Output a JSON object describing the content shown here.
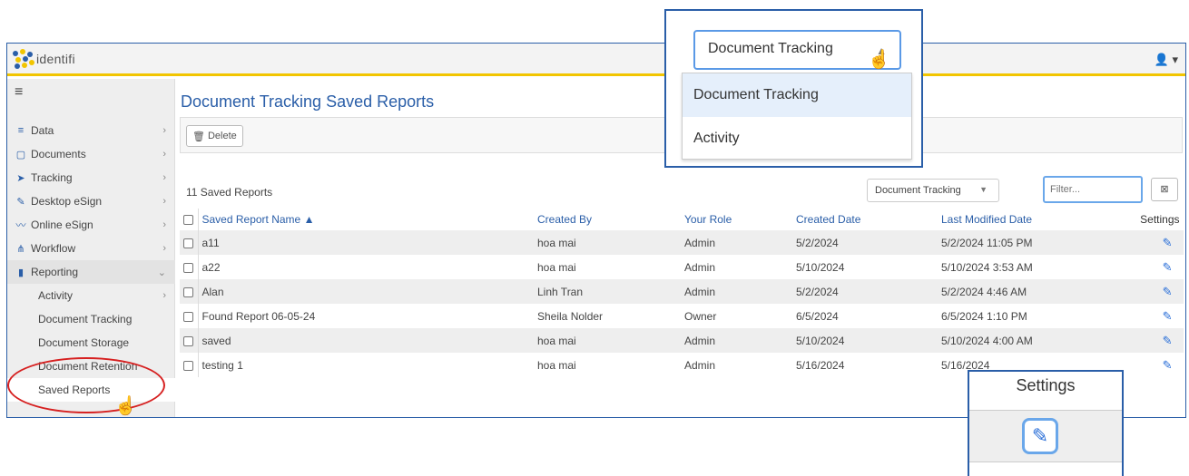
{
  "app": {
    "name": "identifi"
  },
  "sidebar": {
    "items": [
      {
        "label": "Data",
        "icon": "database-icon",
        "glyph": "≡"
      },
      {
        "label": "Documents",
        "icon": "clipboard-icon",
        "glyph": "▢"
      },
      {
        "label": "Tracking",
        "icon": "paper-plane-icon",
        "glyph": "➤"
      },
      {
        "label": "Desktop eSign",
        "icon": "pen-icon",
        "glyph": "✎"
      },
      {
        "label": "Online eSign",
        "icon": "signature-icon",
        "glyph": "〰"
      },
      {
        "label": "Workflow",
        "icon": "sitemap-icon",
        "glyph": "⋔"
      },
      {
        "label": "Reporting",
        "icon": "file-icon",
        "glyph": "▮"
      }
    ],
    "reporting_sub": [
      {
        "label": "Activity"
      },
      {
        "label": "Document Tracking"
      },
      {
        "label": "Document Storage"
      },
      {
        "label": "Document Retention"
      },
      {
        "label": "Saved Reports"
      }
    ]
  },
  "page": {
    "title": "Document Tracking Saved Reports"
  },
  "toolbar": {
    "delete_label": "Delete"
  },
  "list": {
    "count_label": "11 Saved Reports",
    "report_type_selected": "Document Tracking",
    "filter_placeholder": "Filter...",
    "columns": [
      "Saved Report Name",
      "Created By",
      "Your Role",
      "Created Date",
      "Last Modified Date",
      "Settings"
    ],
    "rows": [
      {
        "name": "a11",
        "created_by": "hoa mai",
        "role": "Admin",
        "created": "5/2/2024",
        "modified": "5/2/2024 11:05 PM"
      },
      {
        "name": "a22",
        "created_by": "hoa mai",
        "role": "Admin",
        "created": "5/10/2024",
        "modified": "5/10/2024 3:53 AM"
      },
      {
        "name": "Alan",
        "created_by": "Linh Tran",
        "role": "Admin",
        "created": "5/2/2024",
        "modified": "5/2/2024 4:46 AM"
      },
      {
        "name": "Found Report 06-05-24",
        "created_by": "Sheila Nolder",
        "role": "Owner",
        "created": "6/5/2024",
        "modified": "6/5/2024 1:10 PM"
      },
      {
        "name": "saved",
        "created_by": "hoa mai",
        "role": "Admin",
        "created": "5/10/2024",
        "modified": "5/10/2024 4:00 AM"
      },
      {
        "name": "testing 1",
        "created_by": "hoa mai",
        "role": "Admin",
        "created": "5/16/2024",
        "modified": "5/16/2024"
      }
    ]
  },
  "dropdown_callout": {
    "selected": "Document Tracking",
    "options": [
      "Document Tracking",
      "Activity"
    ]
  },
  "settings_callout": {
    "label": "Settings"
  },
  "colors": {
    "accent": "#2a5ea8",
    "topbar_border": "#f2c500",
    "highlight_ellipse": "#d62020"
  }
}
